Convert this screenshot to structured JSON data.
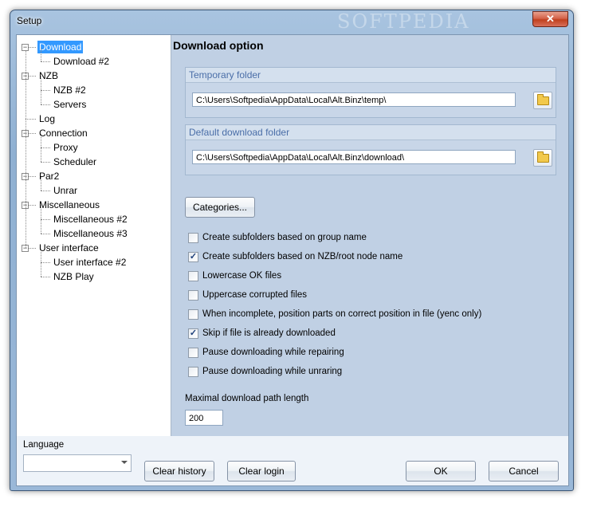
{
  "window": {
    "title": "Setup",
    "close_glyph": "✕",
    "watermark": "SOFTPEDIA"
  },
  "tree": {
    "items": [
      {
        "label": "Download",
        "toggle": "−",
        "selected": true
      },
      {
        "label": "Download #2"
      },
      {
        "label": "NZB",
        "toggle": "−"
      },
      {
        "label": "NZB #2"
      },
      {
        "label": "Servers"
      },
      {
        "label": "Log"
      },
      {
        "label": "Connection",
        "toggle": "−"
      },
      {
        "label": "Proxy"
      },
      {
        "label": "Scheduler"
      },
      {
        "label": "Par2",
        "toggle": "−"
      },
      {
        "label": "Unrar"
      },
      {
        "label": "Miscellaneous",
        "toggle": "−"
      },
      {
        "label": "Miscellaneous #2"
      },
      {
        "label": "Miscellaneous #3"
      },
      {
        "label": "User interface",
        "toggle": "−"
      },
      {
        "label": "User interface #2"
      },
      {
        "label": "NZB Play"
      }
    ]
  },
  "panel": {
    "title": "Download option",
    "temp_folder": {
      "header": "Temporary folder",
      "value": "C:\\Users\\Softpedia\\AppData\\Local\\Alt.Binz\\temp\\"
    },
    "download_folder": {
      "header": "Default download folder",
      "value": "C:\\Users\\Softpedia\\AppData\\Local\\Alt.Binz\\download\\"
    },
    "categories_button": "Categories...",
    "checkboxes": [
      {
        "label": "Create subfolders based on group name",
        "checked": false
      },
      {
        "label": "Create subfolders based on NZB/root node name",
        "checked": true
      },
      {
        "label": "Lowercase OK files",
        "checked": false
      },
      {
        "label": "Uppercase corrupted files",
        "checked": false
      },
      {
        "label": "When incomplete, position parts on correct position in file (yenc only)",
        "checked": false
      },
      {
        "label": "Skip if file is already downloaded",
        "checked": true
      },
      {
        "label": "Pause downloading while repairing",
        "checked": false
      },
      {
        "label": "Pause downloading while unraring",
        "checked": false
      }
    ],
    "check_glyph": "✓",
    "max_path_label": "Maximal download path length",
    "max_path_value": "200"
  },
  "bottom": {
    "language_label": "Language",
    "language_value": "",
    "clear_history": "Clear history",
    "clear_login": "Clear login",
    "ok": "OK",
    "cancel": "Cancel"
  },
  "icons": {
    "browse": "folder-icon",
    "close": "close-icon",
    "dropdown": "chevron-down-icon"
  }
}
